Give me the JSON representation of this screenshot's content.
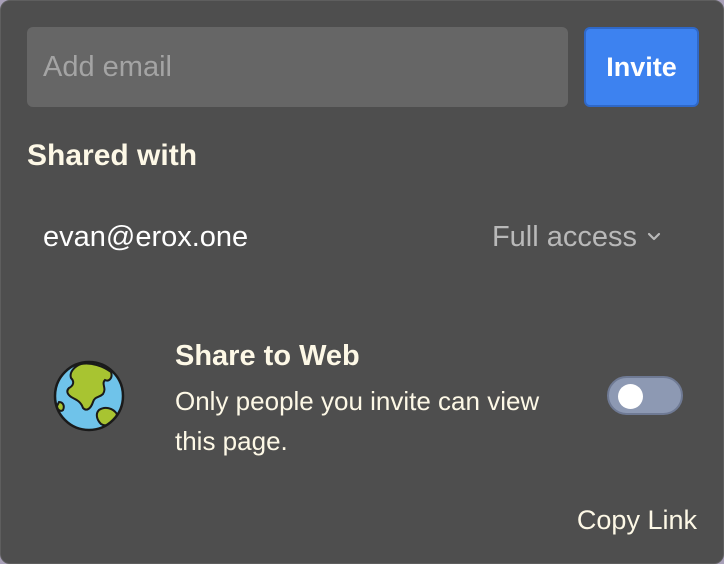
{
  "invite": {
    "email_placeholder": "Add email",
    "email_value": "",
    "button_label": "Invite",
    "button_color": "#3d82f0"
  },
  "shared": {
    "title": "Shared with",
    "users": [
      {
        "email": "evan@erox.one",
        "access": "Full access"
      }
    ]
  },
  "share_web": {
    "icon": "globe-icon",
    "title": "Share to Web",
    "description": "Only people you invite can view this page.",
    "enabled": false
  },
  "footer": {
    "copy_link_label": "Copy Link"
  }
}
